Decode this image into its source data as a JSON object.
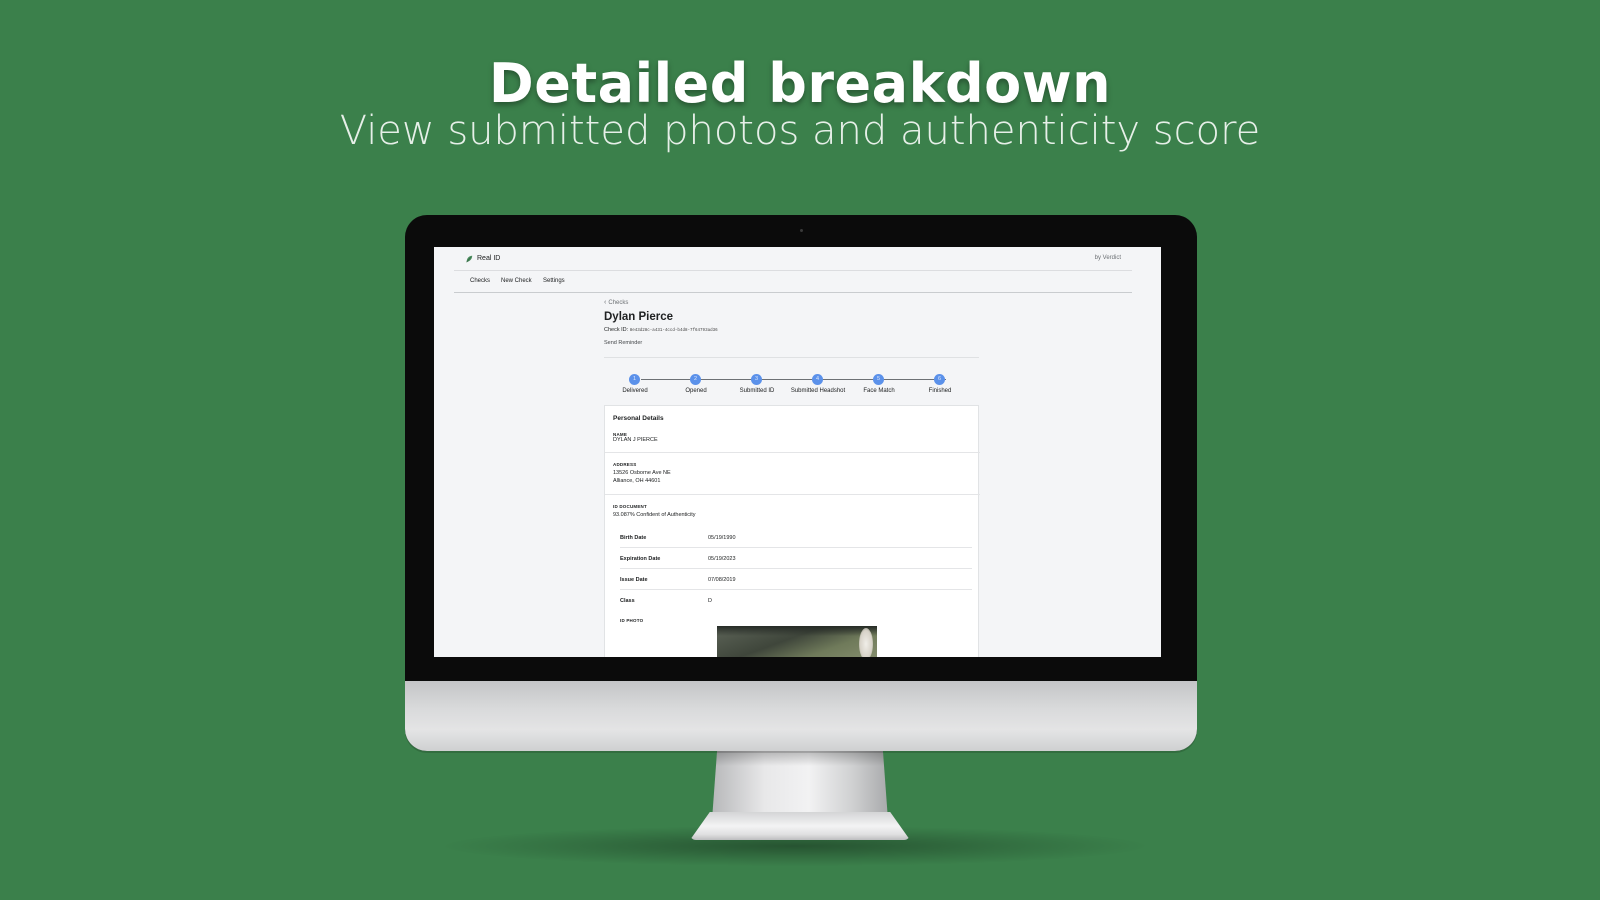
{
  "headline": "Detailed breakdown",
  "subheadline": "View submitted photos and authenticity score",
  "app": {
    "title": "Real ID",
    "by_label": "by Verdict",
    "nav": [
      "Checks",
      "New Check",
      "Settings"
    ]
  },
  "page": {
    "breadcrumb": "Checks",
    "name": "Dylan Pierce",
    "check_id_label": "Check ID:",
    "check_id_value": "8e43d28c-a431-4ccd-b4d8-7f64793ad36",
    "send_reminder": "Send Reminder"
  },
  "steps": [
    {
      "number": "1",
      "label": "Delivered"
    },
    {
      "number": "2",
      "label": "Opened"
    },
    {
      "number": "3",
      "label": "Submitted ID"
    },
    {
      "number": "4",
      "label": "Submitted Headshot"
    },
    {
      "number": "5",
      "label": "Face Match"
    },
    {
      "number": "6",
      "label": "Finished"
    }
  ],
  "details": {
    "title": "Personal Details",
    "name_caption": "NAME",
    "name_value": "DYLAN J PIERCE",
    "address_caption": "ADDRESS",
    "address_line1": "13526 Osborne Ave NE",
    "address_line2": "Alliance, OH 44601",
    "id_doc_caption": "ID DOCUMENT",
    "confidence": "93.087% Confident of Authenticity",
    "rows": [
      {
        "label": "Birth Date",
        "value": "05/19/1990"
      },
      {
        "label": "Expiration Date",
        "value": "05/19/2023"
      },
      {
        "label": "Issue Date",
        "value": "07/08/2019"
      },
      {
        "label": "Class",
        "value": "D"
      }
    ],
    "id_photo_caption": "ID PHOTO"
  },
  "colors": {
    "background": "#3b804b",
    "step_dot": "#5b91ea",
    "screen_bg": "#f4f5f7"
  }
}
